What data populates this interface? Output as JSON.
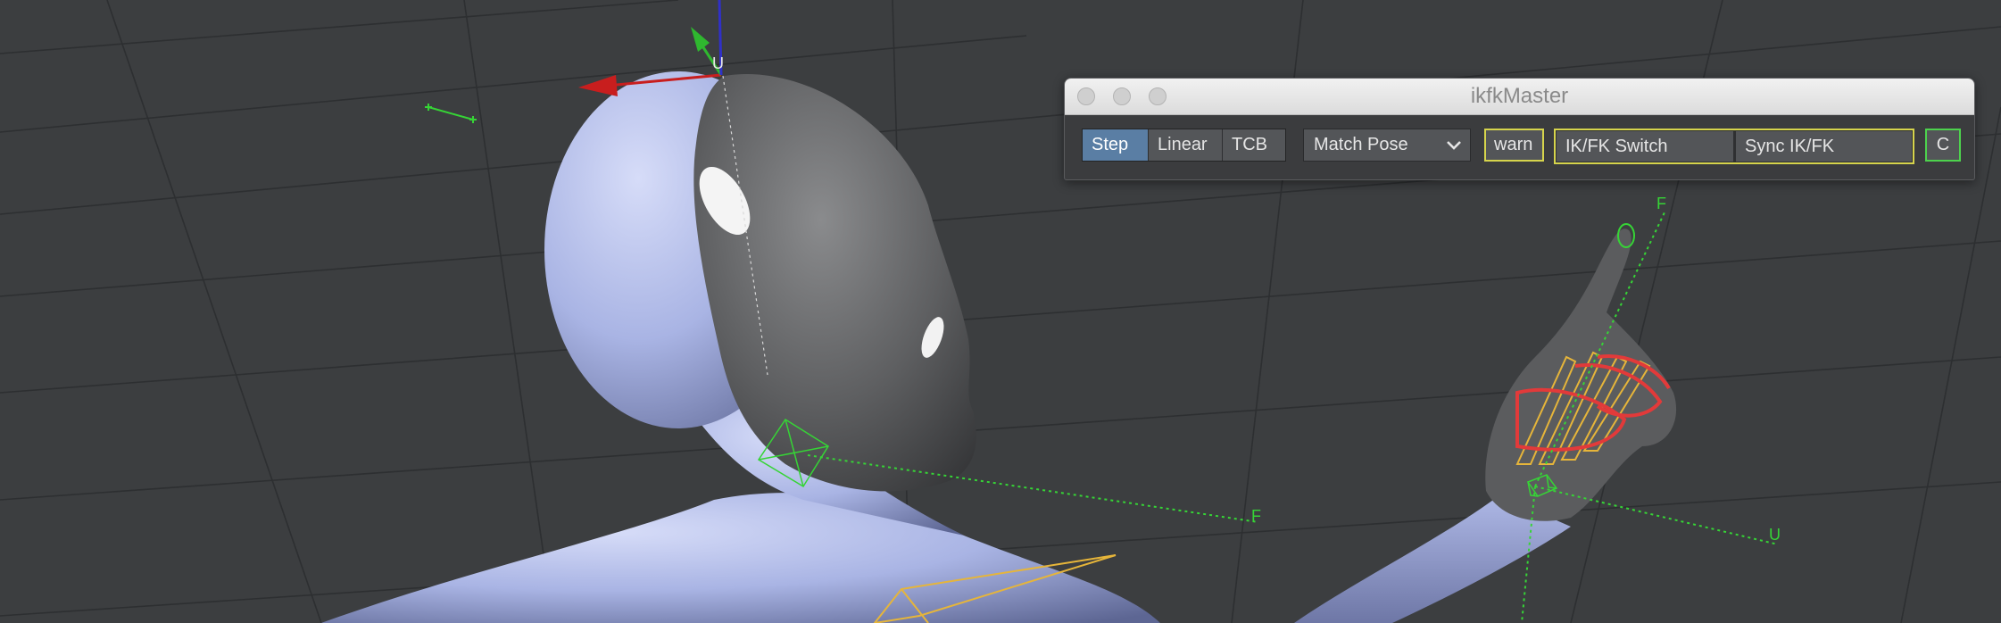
{
  "window": {
    "title": "ikfkMaster"
  },
  "toolbar": {
    "interpolation": {
      "options": [
        "Step",
        "Linear",
        "TCB"
      ],
      "selected": "Step"
    },
    "match_pose": {
      "value": "Match Pose"
    },
    "warn_label": "warn",
    "ik_fk_switch_label": "IK/FK Switch",
    "sync_ik_fk_label": "Sync IK/FK",
    "c_label": "C"
  },
  "viewport": {
    "axis_labels": {
      "up_head": "U",
      "forward_neck": "F",
      "forward_hand": "F",
      "up_hand": "U"
    }
  },
  "colors": {
    "viewport_bg": "#3c3e40",
    "grid_line": "#2e3032",
    "skin": "#a9b5e6",
    "head_mesh": "#6a6b6d",
    "control_green": "#36d436",
    "ik_yellow": "#e6b53a",
    "fk_red": "#e23a3a",
    "active_segment": "#5a7ea4",
    "highlight_yellow": "#d6d44c",
    "highlight_green": "#4dd24d"
  }
}
